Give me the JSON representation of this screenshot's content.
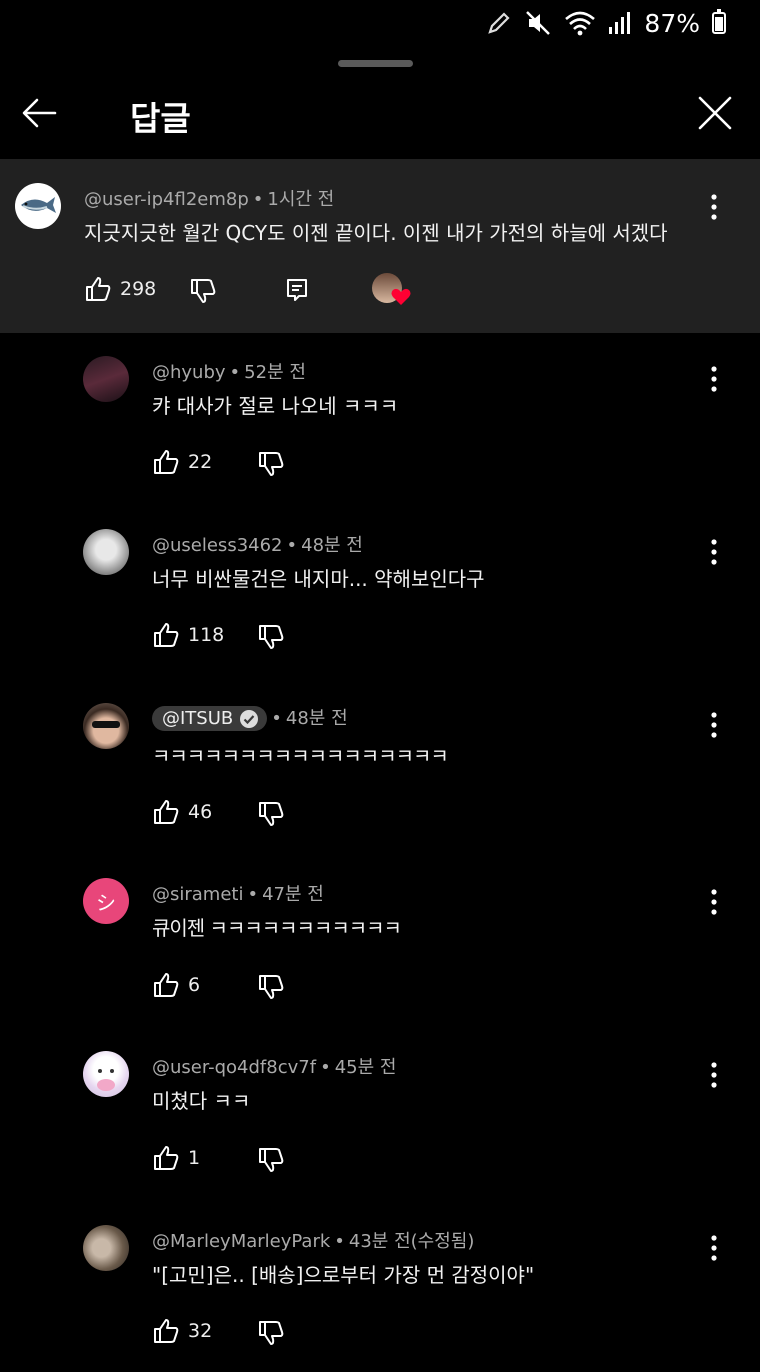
{
  "status_bar": {
    "battery": "87%"
  },
  "header": {
    "title": "답글"
  },
  "parent_comment": {
    "author": "@user-ip4fl2em8p",
    "time": "1시간 전",
    "text": "지긋지긋한 월간 QCY도 이젠 끝이다. 이젠 내가 가전의 하늘에 서겠다",
    "likes": "298"
  },
  "replies": [
    {
      "author": "@hyuby",
      "time": "52분 전",
      "text": "캬 대사가 절로 나오네 ㅋㅋㅋ",
      "likes": "22"
    },
    {
      "author": "@useless3462",
      "time": "48분 전",
      "text": "너무 비싼물건은 내지마... 약해보인다구",
      "likes": "118"
    },
    {
      "author": "@ITSUB",
      "time": "48분 전",
      "text": "ㅋㅋㅋㅋㅋㅋㅋㅋㅋㅋㅋㅋㅋㅋㅋㅋㅋ",
      "likes": "46",
      "verified": true
    },
    {
      "author": "@sirameti",
      "time": "47분 전",
      "text": "큐이젠 ㅋㅋㅋㅋㅋㅋㅋㅋㅋㅋㅋ",
      "likes": "6",
      "avatar_letter": "シ",
      "avatar_color": "#e8467a"
    },
    {
      "author": "@user-qo4df8cv7f",
      "time": "45분 전",
      "text": "미쳤다 ㅋㅋ",
      "likes": "1"
    },
    {
      "author": "@MarleyMarleyPark",
      "time": "43분 전(수정됨)",
      "text": "\"[고민]은.. [배송]으로부터 가장 먼 감정이야\"",
      "likes": "32"
    }
  ],
  "colors": {
    "background": "#000000",
    "parent_background": "#212121",
    "heart": "#ff0033"
  }
}
